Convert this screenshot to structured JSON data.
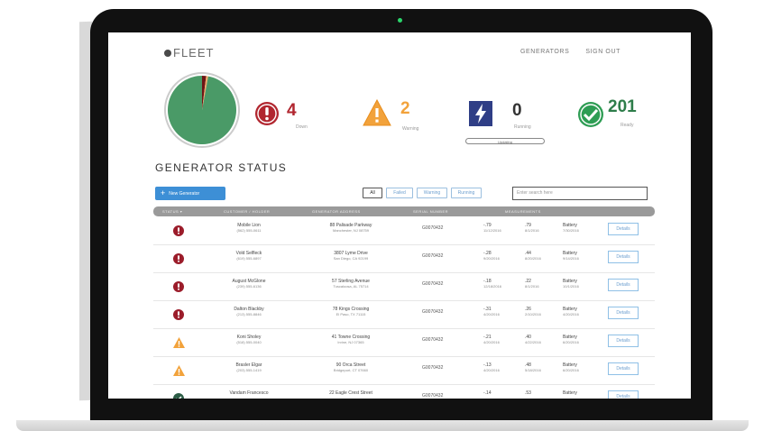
{
  "app": {
    "logo_text": "FLEET"
  },
  "nav": {
    "generators": "GENERATORS",
    "sign_out": "SIGN OUT"
  },
  "summary": {
    "chart_data": {
      "type": "pie",
      "slices": [
        {
          "name": "Down",
          "value": 4,
          "color": "#6e1515"
        },
        {
          "name": "Warning",
          "value": 2,
          "color": "#f0a868"
        },
        {
          "name": "Running",
          "value": 0,
          "color": "#2f3e86"
        },
        {
          "name": "Ready",
          "value": 201,
          "color": "#4a9a67"
        }
      ],
      "title": "",
      "xlabel": "",
      "ylabel": ""
    },
    "down": {
      "count": "4",
      "label": "Down"
    },
    "warning": {
      "count": "2",
      "label": "Warning"
    },
    "running": {
      "count": "0",
      "label": "Running",
      "progress_label": "Updating"
    },
    "ready": {
      "count": "201",
      "label": "Ready"
    },
    "colors": {
      "down": "#b1262f",
      "warning": "#f2a23b",
      "running": "#2f3e86",
      "ready": "#2e9d54"
    }
  },
  "page": {
    "title": "GENERATOR STATUS"
  },
  "toolbar": {
    "add_label": "New Generator",
    "filters": [
      "All",
      "Failed",
      "Warning",
      "Running"
    ],
    "search_placeholder": "Enter search here"
  },
  "table": {
    "headers": [
      "STATUS ▾",
      "CUSTOMER / HOLDER",
      "GENERATOR ADDRESS",
      "SERIAL NUMBER",
      "MEASUREMENTS"
    ],
    "rows": [
      {
        "status": "down",
        "name": "Mobile Lion",
        "phone": "(562) 555-0611",
        "address": "88 Palisade Parkway",
        "city": "Manchester, NJ 08759",
        "serial": "G0070432",
        "m1": "-.79",
        "d1": "11/12/2016",
        "m2": ".79",
        "d2": "8/1/2016",
        "m3": "Battery",
        "d3": "7/30/2016"
      },
      {
        "status": "down",
        "name": "Vold Selfleck",
        "phone": "(619) 555-6897",
        "address": "3807 Lyme Drive",
        "city": "San Diego, CA 92199",
        "serial": "G0070432",
        "m1": "-.28",
        "d1": "9/20/2016",
        "m2": ".44",
        "d2": "8/20/2016",
        "m3": "Battery",
        "d3": "9/14/2016"
      },
      {
        "status": "down",
        "name": "August McGlone",
        "phone": "(239) 555-6136",
        "address": "57 Sterling Avenue",
        "city": "Tuscaloosa, AL 75714",
        "serial": "G0070432",
        "m1": "-.18",
        "d1": "12/18/2016",
        "m2": ".22",
        "d2": "8/1/2016",
        "m3": "Battery",
        "d3": "10/1/2016"
      },
      {
        "status": "down",
        "name": "Dalton Blackby",
        "phone": "(213) 555-8846",
        "address": "78 Kings Crossing",
        "city": "El Paso, TX 71115",
        "serial": "G0070432",
        "m1": "-.31",
        "d1": "4/20/2016",
        "m2": ".26",
        "d2": "2/10/2016",
        "m3": "Battery",
        "d3": "4/20/2016"
      },
      {
        "status": "warning",
        "name": "Koni Sholey",
        "phone": "(518) 555-0040",
        "address": "41 Towne Crossing",
        "city": "Irvine, NJ 07365",
        "serial": "G0070432",
        "m1": "-.21",
        "d1": "4/20/2016",
        "m2": ".40",
        "d2": "4/22/2016",
        "m3": "Battery",
        "d3": "6/20/2016"
      },
      {
        "status": "warning",
        "name": "Brasler Elgar",
        "phone": "(203) 555-1419",
        "address": "90 Orca Street",
        "city": "Bridgeport, CT 07660",
        "serial": "G0070432",
        "m1": "-.13",
        "d1": "4/20/2016",
        "m2": ".48",
        "d2": "5/18/2016",
        "m3": "Battery",
        "d3": "6/20/2016"
      },
      {
        "status": "ready",
        "name": "Vandam Francesco",
        "phone": "",
        "address": "22 Eagle Crest Street",
        "city": "",
        "serial": "G0070432",
        "m1": "-.14",
        "d1": "",
        "m2": ".53",
        "d2": "",
        "m3": "Battery",
        "d3": ""
      }
    ],
    "details_label": "Details"
  }
}
